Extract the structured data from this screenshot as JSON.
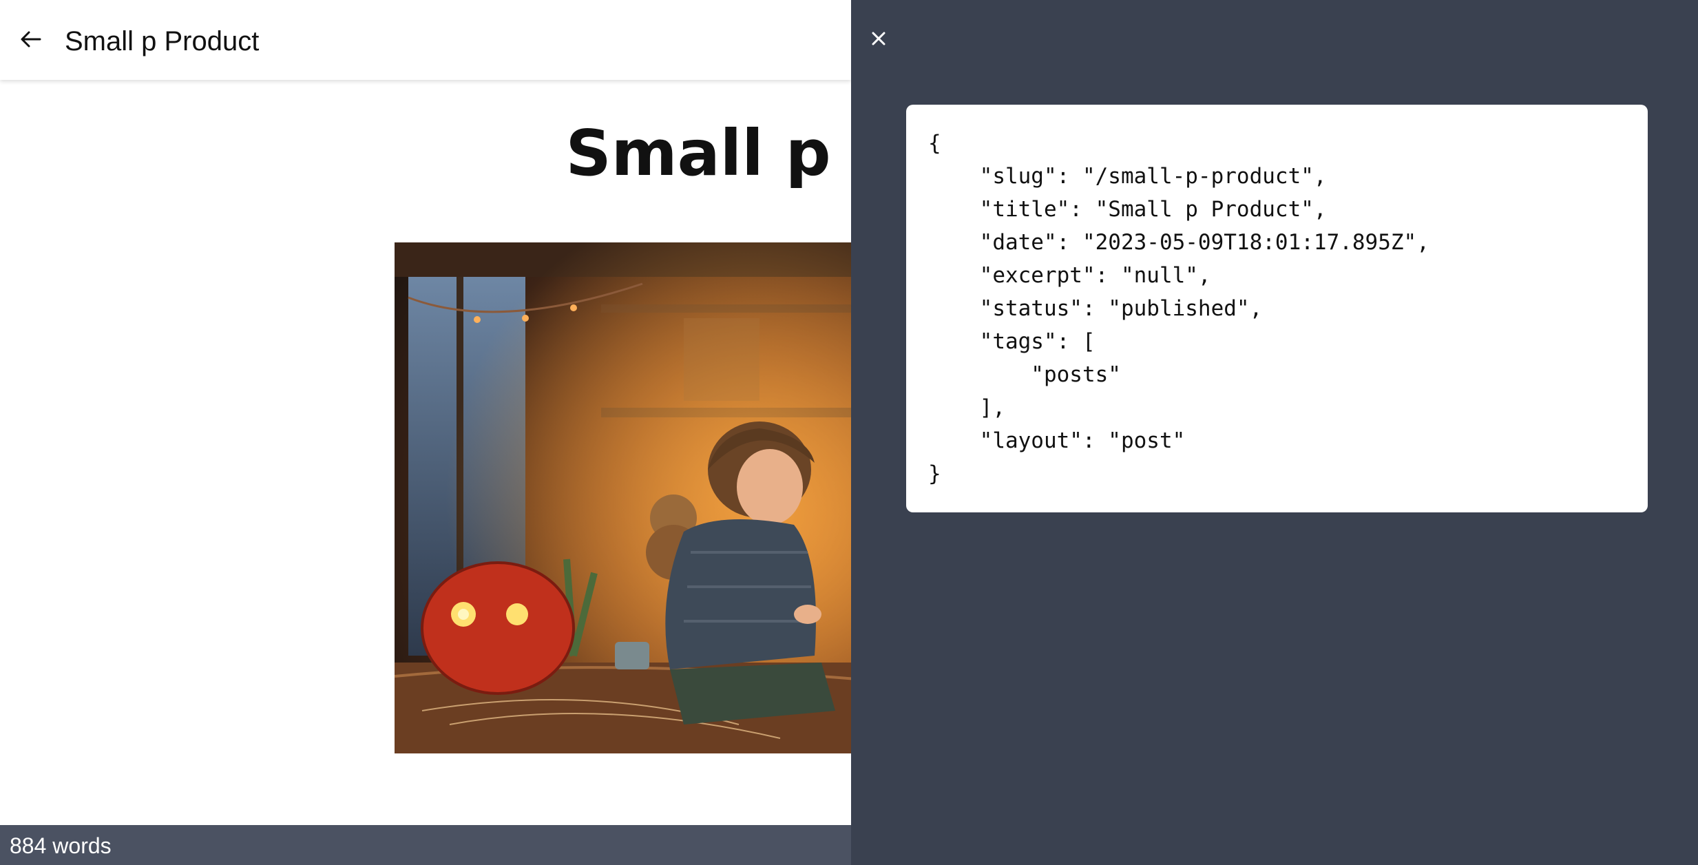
{
  "header": {
    "back_icon": "arrow-left-icon",
    "title": "Small p Product"
  },
  "article": {
    "title": "Small p Product",
    "hero_image_alt": "Child sitting at a wooden workbench with a red round robot in a warm cozy workshop"
  },
  "footer": {
    "word_count": "884 words"
  },
  "drawer": {
    "close_icon": "close-icon",
    "json_text": "{\n    \"slug\": \"/small-p-product\",\n    \"title\": \"Small p Product\",\n    \"date\": \"2023-05-09T18:01:17.895Z\",\n    \"excerpt\": \"null\",\n    \"status\": \"published\",\n    \"tags\": [\n        \"posts\"\n    ],\n    \"layout\": \"post\"\n}"
  },
  "colors": {
    "drawer_background": "#3a4150",
    "footer_background": "#4b5262",
    "card_background": "#ffffff"
  }
}
